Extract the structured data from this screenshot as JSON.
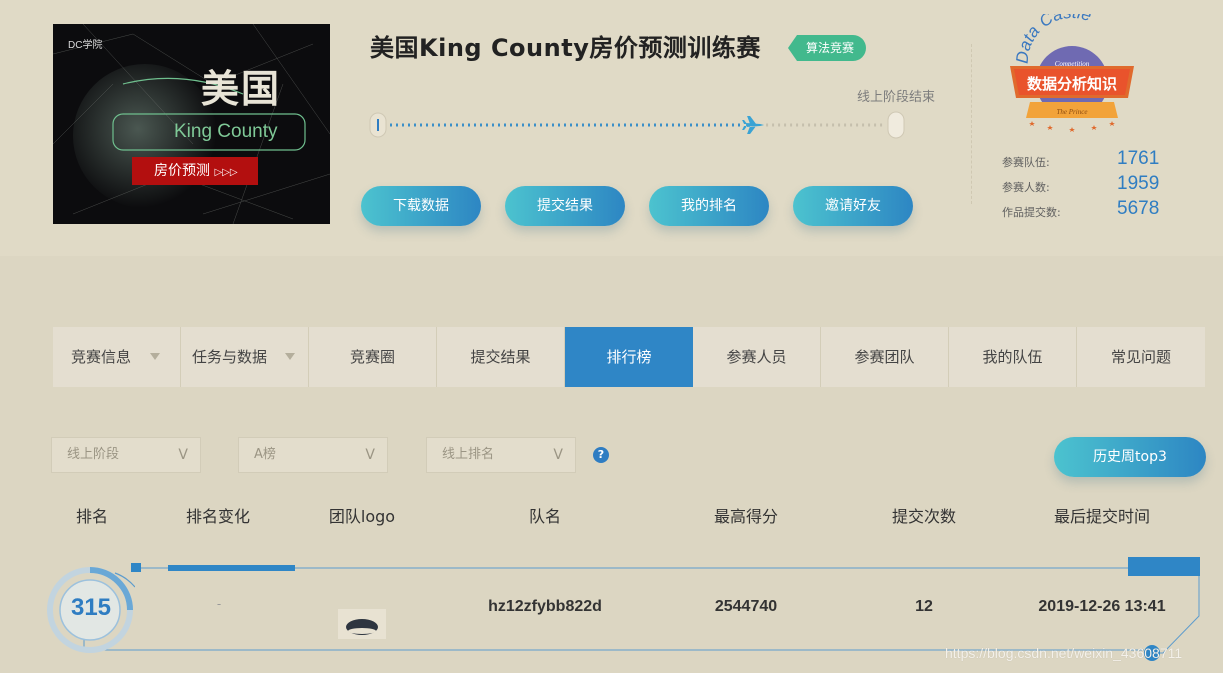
{
  "banner": {
    "logo": "DC学院",
    "country": "美国",
    "county": "King County",
    "badge": "房价预测"
  },
  "competition": {
    "title": "美国King County房价预测训练赛",
    "tag": "算法竞赛",
    "stage_label": "线上阶段结束",
    "progress": 0.73
  },
  "actions": {
    "download": "下载数据",
    "submit": "提交结果",
    "my_rank": "我的排名",
    "invite": "邀请好友"
  },
  "emblem": {
    "arc_text": "Data Castle",
    "sub_text": "Competition",
    "main_text": "数据分析知识",
    "ribbon_text": "The Prince"
  },
  "stats": [
    {
      "label": "参赛队伍:",
      "value": "1761"
    },
    {
      "label": "参赛人数:",
      "value": "1959"
    },
    {
      "label": "作品提交数:",
      "value": "5678"
    }
  ],
  "tabs": [
    {
      "label": "竞赛信息"
    },
    {
      "label": "任务与数据"
    },
    {
      "label": "竞赛圈"
    },
    {
      "label": "提交结果"
    },
    {
      "label": "排行榜"
    },
    {
      "label": "参赛人员"
    },
    {
      "label": "参赛团队"
    },
    {
      "label": "我的队伍"
    },
    {
      "label": "常见问题"
    }
  ],
  "filters": {
    "stage": "线上阶段",
    "board": "A榜",
    "ranking": "线上排名",
    "chevron": "V",
    "help": "?",
    "history": "历史周top3"
  },
  "table": {
    "headers": [
      "排名",
      "排名变化",
      "团队logo",
      "队名",
      "最高得分",
      "提交次数",
      "最后提交时间"
    ],
    "row": {
      "rank": "315",
      "change": "-",
      "team": "hz12zfybb822d",
      "score": "2544740",
      "submissions": "12",
      "last_time": "2019-12-26 13:41"
    }
  },
  "watermark": "https://blog.csdn.net/weixin_43608711",
  "colors": {
    "accent": "#2f86c6",
    "tag_green": "#42b98d",
    "background": "#dcd6c2"
  }
}
